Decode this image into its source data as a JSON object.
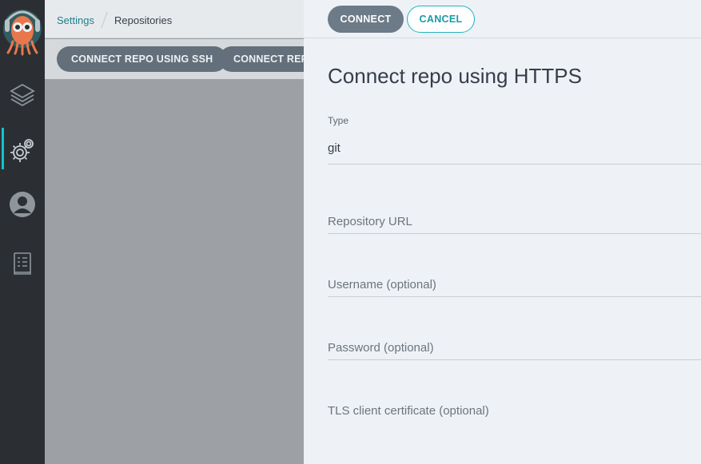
{
  "breadcrumb": {
    "parent": "Settings",
    "current": "Repositories"
  },
  "toolbar": {
    "ssh_label": "CONNECT REPO USING SSH",
    "https_label": "CONNECT REPO USING HTTPS"
  },
  "panel": {
    "connect_label": "CONNECT",
    "cancel_label": "CANCEL",
    "title": "Connect repo using HTTPS",
    "type_label": "Type",
    "type_value": "git",
    "repo_url_placeholder": "Repository URL",
    "username_placeholder": "Username (optional)",
    "password_placeholder": "Password (optional)",
    "tls_placeholder": "TLS client certificate (optional)"
  },
  "nav": {
    "items": [
      "argo-logo-icon",
      "layers-icon",
      "settings-icon",
      "user-icon",
      "docs-icon"
    ],
    "active": "settings-icon"
  },
  "colors": {
    "accent": "#11c3cc",
    "nav_bg": "#2b2f33",
    "panel_bg": "#eef2f6"
  }
}
